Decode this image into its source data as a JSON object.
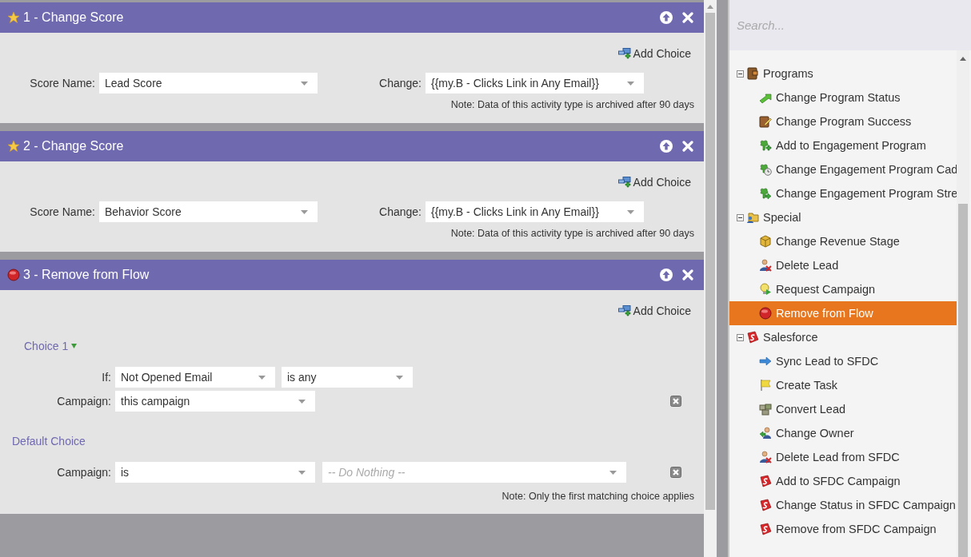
{
  "steps": [
    {
      "kind": "score",
      "title": "1 - Change Score",
      "add_choice": "Add Choice",
      "score_name_label": "Score Name:",
      "score_name": "Lead Score",
      "change_label": "Change:",
      "change": "{{my.B - Clicks Link in Any Email}}",
      "note": "Note: Data of this activity type is archived after 90 days"
    },
    {
      "kind": "score",
      "title": "2 - Change Score",
      "add_choice": "Add Choice",
      "score_name_label": "Score Name:",
      "score_name": "Behavior Score",
      "change_label": "Change:",
      "change": "{{my.B - Clicks Link in Any Email}}",
      "note": "Note: Data of this activity type is archived after 90 days"
    },
    {
      "kind": "remove",
      "title": "3 - Remove from Flow",
      "add_choice": "Add Choice",
      "choices": [
        {
          "title": "Choice 1",
          "if_label": "If:",
          "if_value": "Not Opened Email",
          "operator": "is any",
          "campaign_label": "Campaign:",
          "campaign": "this campaign"
        }
      ],
      "default_choice": {
        "title": "Default Choice",
        "campaign_label": "Campaign:",
        "operator": "is",
        "placeholder": "-- Do Nothing --"
      },
      "note": "Note: Only the first matching choice applies"
    }
  ],
  "sidebar": {
    "search": {
      "placeholder": "Search..."
    },
    "tree": [
      {
        "kind": "category",
        "label": "Programs",
        "expanded": true,
        "children": [
          {
            "kind": "action",
            "label": "Change Program Status",
            "selected": false
          },
          {
            "kind": "action",
            "label": "Change Program Success",
            "selected": false
          },
          {
            "kind": "action",
            "label": "Add to Engagement Program",
            "selected": false
          },
          {
            "kind": "action",
            "label": "Change Engagement Program Cad",
            "selected": false
          },
          {
            "kind": "action",
            "label": "Change Engagement Program Stre",
            "selected": false
          }
        ]
      },
      {
        "kind": "category",
        "label": "Special",
        "expanded": true,
        "children": [
          {
            "kind": "action",
            "label": "Change Revenue Stage",
            "selected": false
          },
          {
            "kind": "action",
            "label": "Delete Lead",
            "selected": false
          },
          {
            "kind": "action",
            "label": "Request Campaign",
            "selected": false
          },
          {
            "kind": "action",
            "label": "Remove from Flow",
            "selected": true
          }
        ]
      },
      {
        "kind": "category",
        "label": "Salesforce",
        "expanded": true,
        "children": [
          {
            "kind": "action",
            "label": "Sync Lead to SFDC",
            "selected": false
          },
          {
            "kind": "action",
            "label": "Create Task",
            "selected": false
          },
          {
            "kind": "action",
            "label": "Convert Lead",
            "selected": false
          },
          {
            "kind": "action",
            "label": "Change Owner",
            "selected": false
          },
          {
            "kind": "action",
            "label": "Delete Lead from SFDC",
            "selected": false
          },
          {
            "kind": "action",
            "label": "Add to SFDC Campaign",
            "selected": false
          },
          {
            "kind": "action",
            "label": "Change Status in SFDC Campaign",
            "selected": false
          },
          {
            "kind": "action",
            "label": "Remove from SFDC Campaign",
            "selected": false
          }
        ]
      }
    ]
  }
}
